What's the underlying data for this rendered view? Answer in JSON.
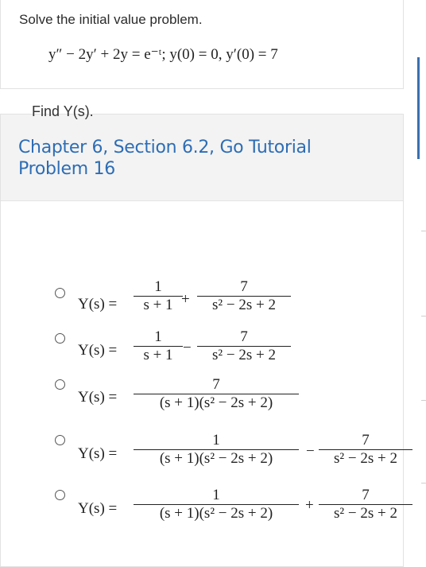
{
  "problem": {
    "prompt": "Solve the initial value problem.",
    "equation": "y″ − 2y′ + 2y = e⁻ᵗ;  y(0) = 0, y′(0) = 7"
  },
  "tutorial": {
    "title_line1": "Chapter 6, Section 6.2, Go Tutorial",
    "title_line2": "Problem 16",
    "find_label": "Find Y(s)."
  },
  "options": [
    {
      "lhs": "Y(s) =",
      "t1_num": "1",
      "t1_den": "s + 1",
      "op": "+",
      "t2_num": "7",
      "t2_den": "s² − 2s + 2"
    },
    {
      "lhs": "Y(s) =",
      "t1_num": "1",
      "t1_den": "s + 1",
      "op": "−",
      "t2_num": "7",
      "t2_den": "s² − 2s + 2"
    },
    {
      "lhs": "Y(s) =",
      "t1_num": "7",
      "t1_den": "(s + 1)(s² − 2s + 2)"
    },
    {
      "lhs": "Y(s) =",
      "t1_num": "1",
      "t1_den": "(s + 1)(s² − 2s + 2)",
      "op": "−",
      "t2_num": "7",
      "t2_den": "s² − 2s + 2"
    },
    {
      "lhs": "Y(s) =",
      "t1_num": "1",
      "t1_den": "(s + 1)(s² − 2s + 2)",
      "op": "+",
      "t2_num": "7",
      "t2_den": "s² − 2s + 2"
    }
  ]
}
